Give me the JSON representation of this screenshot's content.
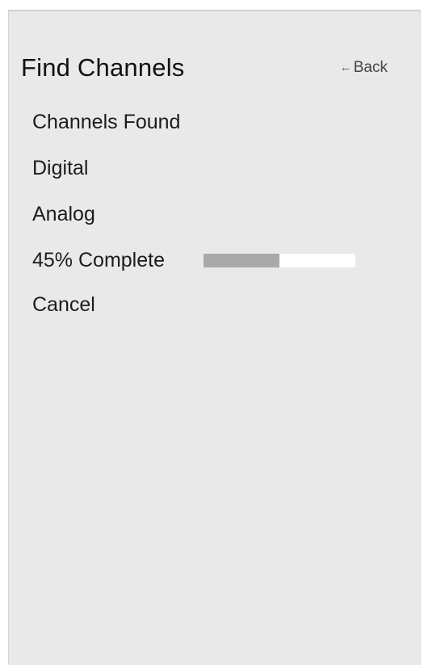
{
  "header": {
    "title": "Find Channels",
    "back_icon": "left-arrow-icon",
    "back_label": "Back"
  },
  "menu": {
    "channels_found": "Channels Found",
    "digital": "Digital",
    "analog": "Analog",
    "cancel": "Cancel"
  },
  "progress": {
    "label": "45% Complete",
    "fraction": 0.5
  },
  "colors": {
    "background": "#e9e9e9",
    "progress_fill": "#a9a9a9",
    "progress_track": "#ffffff"
  }
}
